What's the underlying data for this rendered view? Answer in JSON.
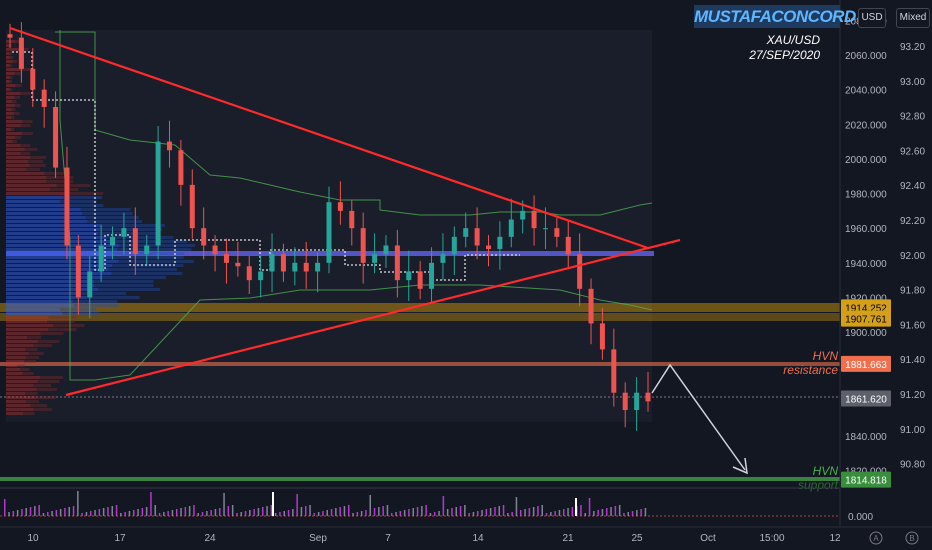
{
  "branding": {
    "author": "MUSTAFACONCORD"
  },
  "header": {
    "symbol": "XAU/USD",
    "date": "27/SEP/2020",
    "currency_button": "USD",
    "scale_button": "Mixed"
  },
  "colors": {
    "background": "#131722",
    "trendline": "#ff2a2a",
    "hvn_band": "#5b5bd6",
    "resistance": "#ef6f4f",
    "support": "#4caf50",
    "fib_band": "#b8860b",
    "candle_up": "#26a69a",
    "candle_down": "#ef5350",
    "arrow": "#d1d4dc"
  },
  "annotations": {
    "resistance": {
      "line1": "HVN",
      "line2": "resistance"
    },
    "support": {
      "line1": "HVN",
      "line2": "support"
    }
  },
  "price_tags": [
    {
      "label": "1914.252",
      "price": 1914.252,
      "bg": "#d4a017",
      "fg": "#000000"
    },
    {
      "label": "1907.761",
      "price": 1907.761,
      "bg": "#d4a017",
      "fg": "#000000"
    },
    {
      "label": "1881.663",
      "price": 1881.663,
      "bg": "#ef6f4f",
      "fg": "#ffffff"
    },
    {
      "label": "1861.620",
      "price": 1861.62,
      "bg": "#5d606b",
      "fg": "#ffffff"
    },
    {
      "label": "1814.818",
      "price": 1814.818,
      "bg": "#388e3c",
      "fg": "#ffffff"
    }
  ],
  "chart_data": {
    "type": "candlestick",
    "symbol": "XAU/USD",
    "y_axis_left": {
      "ticks": [
        "2080.000",
        "2060.000",
        "2040.000",
        "2020.000",
        "2000.000",
        "1980.000",
        "1960.000",
        "1940.000",
        "1920.000",
        "1900.000",
        "1880.000",
        "1860.000",
        "1840.000",
        "1820.000"
      ],
      "range": [
        1810,
        2090
      ]
    },
    "y_axis_right": {
      "ticks": [
        "93.20",
        "93.00",
        "92.80",
        "92.60",
        "92.40",
        "92.20",
        "92.00",
        "91.80",
        "91.60",
        "91.40",
        "91.20",
        "91.00",
        "90.80"
      ]
    },
    "volume_axis_label": "0.000",
    "x_axis_ticks": [
      "10",
      "17",
      "24",
      "Sep",
      "7",
      "14",
      "21",
      "25",
      "Oct",
      "15:00",
      "12"
    ],
    "levels": {
      "hvn_line": 1945.5,
      "fib_band_upper": [
        1912,
        1917
      ],
      "fib_band_lower": [
        1905,
        1910
      ],
      "hvn_resistance": 1881.663,
      "last_price": 1861.62,
      "hvn_support": 1814.818
    },
    "closes": [
      2070,
      2052,
      2040,
      2030,
      1995,
      1950,
      1920,
      1935,
      1950,
      1955,
      1960,
      1945,
      1950,
      2010,
      2005,
      1985,
      1960,
      1950,
      1945,
      1940,
      1938,
      1930,
      1935,
      1945,
      1935,
      1940,
      1935,
      1940,
      1975,
      1970,
      1960,
      1940,
      1945,
      1950,
      1930,
      1935,
      1925,
      1940,
      1945,
      1955,
      1960,
      1950,
      1948,
      1955,
      1965,
      1970,
      1960,
      1960,
      1955,
      1945,
      1925,
      1905,
      1890,
      1865,
      1855,
      1865,
      1860
    ]
  }
}
